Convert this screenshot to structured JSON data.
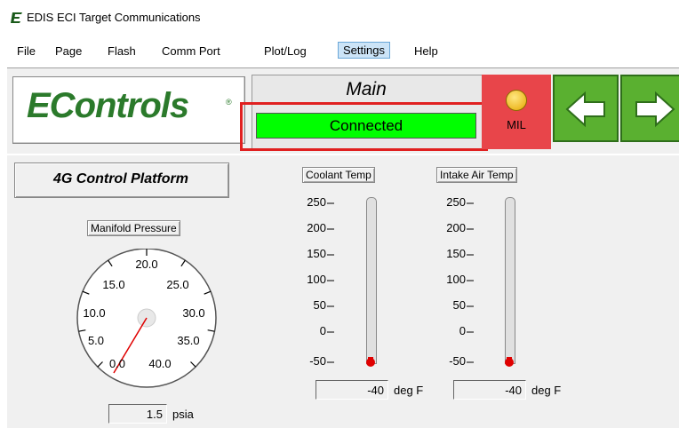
{
  "window": {
    "title": "EDIS ECI Target Communications",
    "app_icon": "e-logo-icon"
  },
  "menu": {
    "items": [
      {
        "label": "File"
      },
      {
        "label": "Page"
      },
      {
        "label": "Flash"
      },
      {
        "label": "Comm Port"
      },
      {
        "label": "Plot/Log"
      },
      {
        "label": "Settings"
      },
      {
        "label": "Help"
      }
    ],
    "selected": "Settings"
  },
  "header": {
    "logo_text": "EControls",
    "logo_reg": "®",
    "screen_title": "Main",
    "connection_status": "Connected",
    "connection_status_color": "#00ff00",
    "mil_label": "MIL",
    "mil_color": "#e6a800",
    "nav": {
      "back_icon": "arrow-left-icon",
      "forward_icon": "arrow-right-icon"
    }
  },
  "platform_label": "4G Control Platform",
  "manifold_pressure": {
    "caption": "Manifold Pressure",
    "scale_labels": [
      "0.0",
      "5.0",
      "10.0",
      "15.0",
      "20.0",
      "25.0",
      "30.0",
      "35.0",
      "40.0"
    ],
    "value": "1.5",
    "unit": "psia"
  },
  "coolant_temp": {
    "caption": "Coolant Temp",
    "scale_labels": [
      "250",
      "200",
      "150",
      "100",
      "50",
      "0",
      "-50"
    ],
    "value": "-40",
    "unit": "deg F"
  },
  "intake_air_temp": {
    "caption": "Intake Air Temp",
    "scale_labels": [
      "250",
      "200",
      "150",
      "100",
      "50",
      "0",
      "-50"
    ],
    "value": "-40",
    "unit": "deg F"
  },
  "colors": {
    "accent_green": "#5ab030",
    "logo_green": "#2b7a2b",
    "highlight_red": "#e02020",
    "mil_bg": "#e8454a"
  }
}
